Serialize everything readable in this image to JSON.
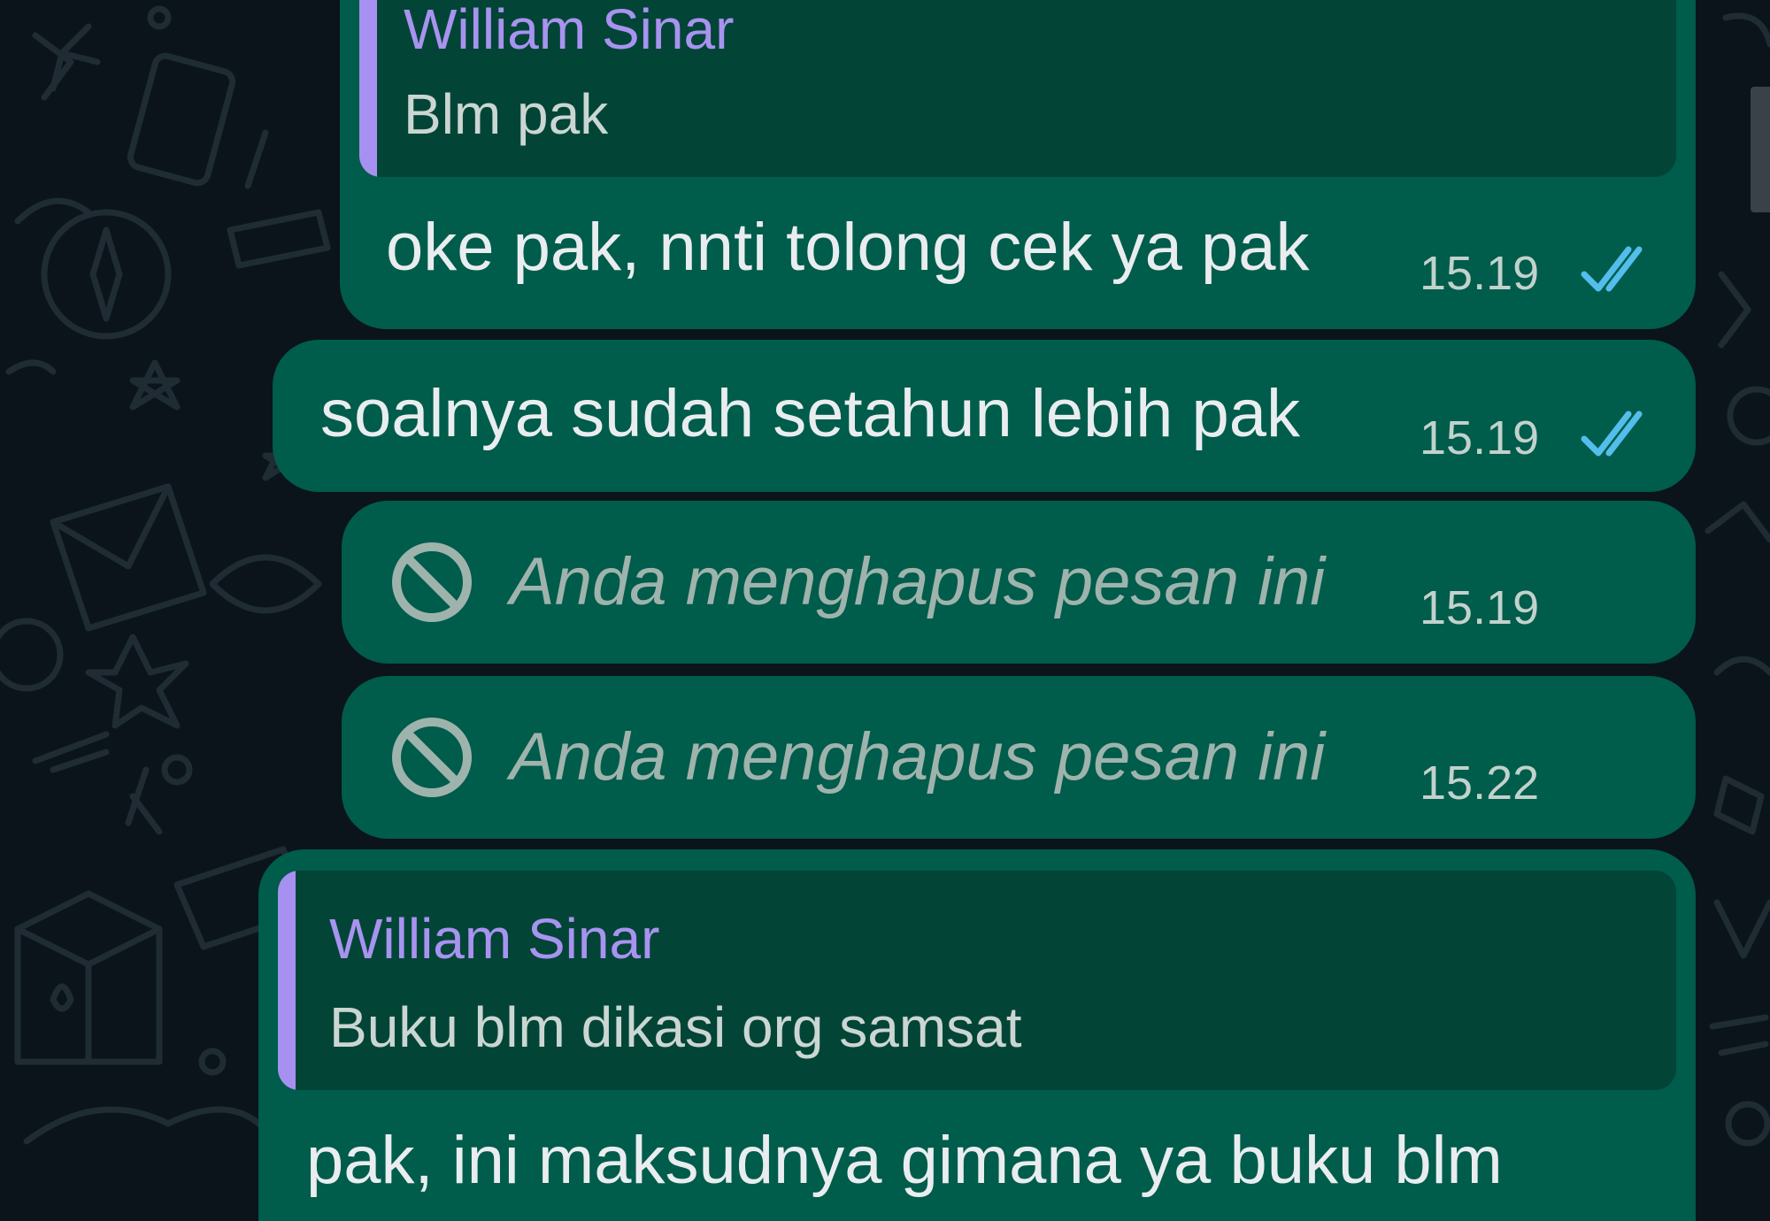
{
  "colors": {
    "background": "#0b141a",
    "bubble_outgoing": "#005c4b",
    "quote_background": "#024537",
    "quote_accent": "#a791f0",
    "read_ticks": "#53bdeb"
  },
  "messages": [
    {
      "quote": {
        "author": "William Sinar",
        "text": "Blm pak"
      },
      "text": "oke pak, nnti tolong cek ya pak",
      "time": "15.19",
      "status_icon": "double-check-read-icon"
    },
    {
      "text": "soalnya sudah setahun lebih pak",
      "time": "15.19",
      "status_icon": "double-check-read-icon"
    },
    {
      "deleted": true,
      "text": "Anda menghapus pesan ini",
      "time": "15.19",
      "status_icon": "prohibited-icon"
    },
    {
      "deleted": true,
      "text": "Anda menghapus pesan ini",
      "time": "15.22",
      "status_icon": "prohibited-icon"
    },
    {
      "quote": {
        "author": "William Sinar",
        "text": "Buku blm dikasi org samsat"
      },
      "text": "pak, ini maksudnya gimana ya buku blm"
    }
  ]
}
